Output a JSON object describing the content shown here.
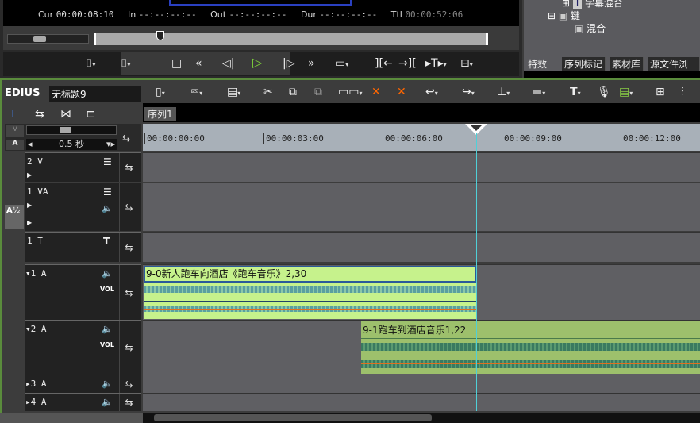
{
  "player": {
    "cur_label": "Cur",
    "cur": "00:00:08:10",
    "in_label": "In",
    "in": "--:--:--:--",
    "out_label": "Out",
    "out": "--:--:--:--",
    "dur_label": "Dur",
    "dur": "--:--:--:--",
    "ttl_label": "Ttl",
    "ttl": "00:00:52:06",
    "scrub_position_fraction": 0.16
  },
  "effects_tree": {
    "items": [
      "字幕混合",
      "键",
      "混合"
    ]
  },
  "panel_tabs": [
    "特效",
    "序列标记",
    "素材库",
    "源文件浏览"
  ],
  "app": {
    "name": "EDIUS",
    "project_title": "无标题9"
  },
  "sequence_tab": "序列1",
  "zoom": {
    "value": "0.5 秒"
  },
  "ruler": {
    "labels": [
      "00:00:00:00",
      "00:00:03:00",
      "00:00:06:00",
      "00:00:09:00",
      "00:00:12:00"
    ],
    "playhead": "00:00:08:10"
  },
  "tracks": [
    {
      "name": "2 V"
    },
    {
      "name": "1 VA"
    },
    {
      "name": "1 T"
    },
    {
      "name": "1 A",
      "vol": "VOL"
    },
    {
      "name": "2 A",
      "vol": "VOL"
    },
    {
      "name": "3 A"
    },
    {
      "name": "4 A"
    }
  ],
  "patch_label": "A",
  "clips": [
    {
      "title": "9-0新人跑车向酒店《跑车音乐》2,30",
      "color": "#c6f28c"
    },
    {
      "title": "9-1跑车到酒店音乐1,22",
      "color": "#9dc06c"
    }
  ],
  "colors": {
    "accent": "#7fd63a",
    "playhead": "#4fd0d8",
    "border": "#5a8c3c"
  }
}
